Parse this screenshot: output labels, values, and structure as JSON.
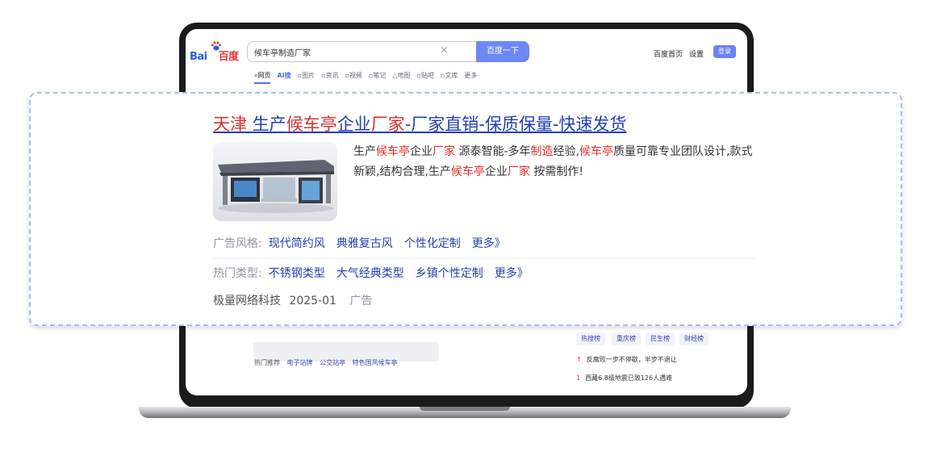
{
  "browser": {
    "logo": {
      "part1": "Bai",
      "part2": "百度"
    },
    "search": {
      "query": "候车亭制造厂家",
      "button": "百度一下"
    },
    "top_links": [
      "百度首页",
      "设置"
    ],
    "login": "登录",
    "tabs": [
      "网页",
      "AI搜",
      "图片",
      "资讯",
      "视频",
      "笔记",
      "地图",
      "贴吧",
      "文库",
      "更多"
    ]
  },
  "background": {
    "related_label": "热门推荐",
    "related_links": [
      "电子站牌",
      "公交站亭",
      "特色国风候车亭"
    ],
    "hot_tabs": [
      "热搜榜",
      "重庆榜",
      "民生榜",
      "财经榜"
    ],
    "hot_list": [
      {
        "rank": "↑",
        "text": "反腐败一步不停歇，半步不退让"
      },
      {
        "rank": "1",
        "text": "西藏6.8级地震已致126人遇难"
      }
    ]
  },
  "ad": {
    "title": {
      "p1": "天津",
      "p2": " 生产",
      "p3": "候车亭",
      "p4": "企业",
      "p5": "厂家",
      "p6": "-厂家直销-保质保量-快速发货"
    },
    "desc": {
      "d1": "生产",
      "d2": "候车亭",
      "d3": "企业",
      "d4": "厂家",
      "d5": " 源泰智能-多年",
      "d6": "制造",
      "d7": "经验,",
      "d8": "候车亭",
      "d9": "质量可靠专业团队设计,款式新颖,结构合理,生产",
      "d10": "候车亭",
      "d11": "企业",
      "d12": "厂家",
      "d13": " 按需制作!"
    },
    "style_row": {
      "label": "广告风格:",
      "links": [
        "现代简约风",
        "典雅复古风",
        "个性化定制",
        "更多》"
      ]
    },
    "type_row": {
      "label": "热门类型:",
      "links": [
        "不锈钢类型",
        "大气经典类型",
        "乡镇个性定制",
        "更多》"
      ]
    },
    "footer": {
      "company": "极量网络科技",
      "date": "2025-01",
      "ad_label": "广告"
    }
  },
  "colors": {
    "brand_blue": "#4e6ef2",
    "link_blue": "#2440b3",
    "highlight_red": "#e02e2e",
    "dashed_border": "#a9c0f3"
  }
}
